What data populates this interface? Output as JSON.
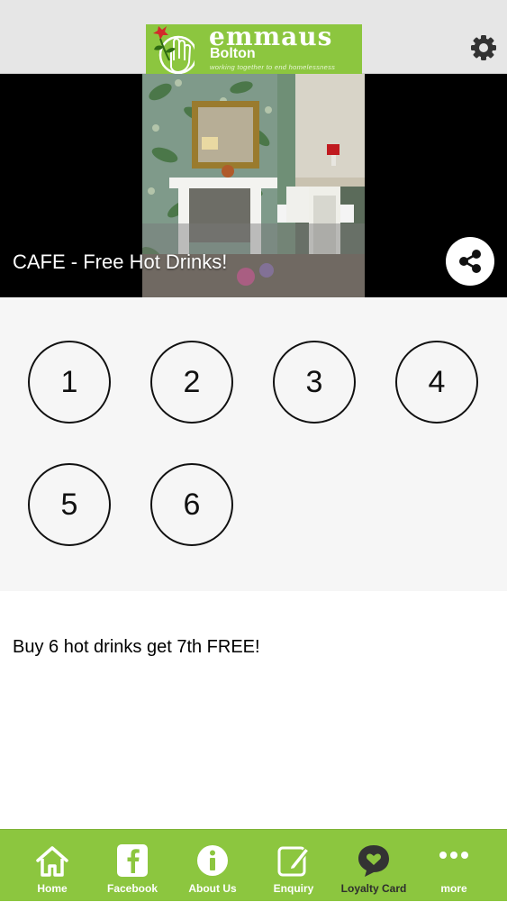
{
  "app": {
    "brand": "emmaus",
    "city": "Bolton",
    "tagline": "working together to end homelessness",
    "settings_icon": "gear-icon",
    "brand_color": "#8cc63f"
  },
  "hero": {
    "title": "CAFE - Free Hot Drinks!",
    "share_icon": "share-icon"
  },
  "loyalty": {
    "stamps": [
      "1",
      "2",
      "3",
      "4",
      "5",
      "6"
    ],
    "description": "Buy 6 hot drinks get 7th FREE!"
  },
  "tabs": [
    {
      "label": "Home",
      "icon": "home-icon"
    },
    {
      "label": "Facebook",
      "icon": "facebook-icon"
    },
    {
      "label": "About Us",
      "icon": "info-icon"
    },
    {
      "label": "Enquiry",
      "icon": "edit-icon"
    },
    {
      "label": "Loyalty Card",
      "icon": "heart-bubble-icon",
      "active": true
    },
    {
      "label": "more",
      "icon": "more-icon"
    }
  ]
}
